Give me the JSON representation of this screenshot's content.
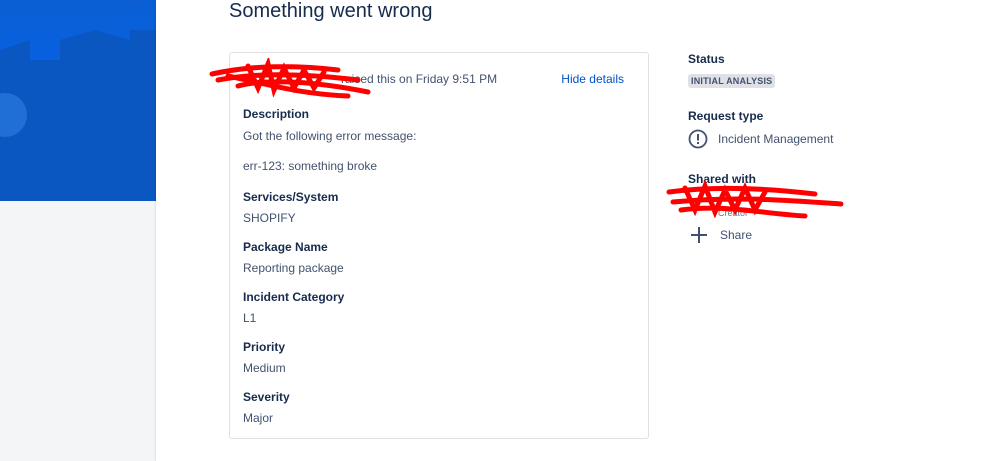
{
  "page": {
    "title": "Something went wrong"
  },
  "request": {
    "raised_text": "raised this on Friday 9:51 PM",
    "hide_details_label": "Hide details",
    "fields": [
      {
        "label": "Description",
        "value": "Got the following error message:",
        "value2": "err-123: something broke"
      },
      {
        "label": "Services/System",
        "value": "SHOPIFY"
      },
      {
        "label": "Package Name",
        "value": "Reporting package"
      },
      {
        "label": "Incident Category",
        "value": "L1"
      },
      {
        "label": "Priority",
        "value": "Medium"
      },
      {
        "label": "Severity",
        "value": "Major"
      }
    ]
  },
  "sidebar": {
    "status_label": "Status",
    "status_value": "INITIAL ANALYSIS",
    "request_type_label": "Request type",
    "request_type_value": "Incident Management",
    "request_type_icon": "alert-circle-icon",
    "shared_with_label": "Shared with",
    "creator_role": "Creator",
    "share_label": "Share",
    "share_icon": "plus-icon"
  },
  "colors": {
    "header_blue": "#0065ff",
    "link": "#0052cc",
    "redaction": "#ff0000"
  }
}
